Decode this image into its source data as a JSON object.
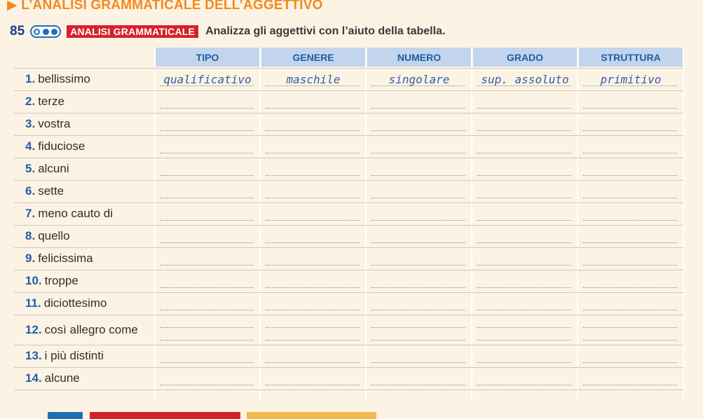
{
  "section_title": "▶ L’ANALISI GRAMMATICALE DELL’AGGETTIVO",
  "exercise": {
    "number": "85",
    "tag": "ANALISI GRAMMATICALE",
    "instruction": "Analizza gli aggettivi con l’aiuto della tabella."
  },
  "columns": [
    "TIPO",
    "GENERE",
    "NUMERO",
    "GRADO",
    "STRUTTURA"
  ],
  "example_answers": [
    "qualificativo",
    "maschile",
    "singolare",
    "sup. assoluto",
    "primitivo"
  ],
  "rows": [
    {
      "n": "1.",
      "word": "bellissimo"
    },
    {
      "n": "2.",
      "word": "terze"
    },
    {
      "n": "3.",
      "word": "vostra"
    },
    {
      "n": "4.",
      "word": "fiduciose"
    },
    {
      "n": "5.",
      "word": "alcuni"
    },
    {
      "n": "6.",
      "word": "sette"
    },
    {
      "n": "7.",
      "word": "meno cauto di"
    },
    {
      "n": "8.",
      "word": "quello"
    },
    {
      "n": "9.",
      "word": "felicissima"
    },
    {
      "n": "10.",
      "word": "troppe"
    },
    {
      "n": "11.",
      "word": "diciottesimo"
    },
    {
      "n": "12.",
      "word": "così allegro come"
    },
    {
      "n": "13.",
      "word": "i più distinti"
    },
    {
      "n": "14.",
      "word": "alcune"
    }
  ],
  "colors": {
    "page_bg": "#fdf3e4",
    "section_title": "#f18a1c",
    "header_bg": "#c2d5ec",
    "header_text": "#1e5ea7",
    "tag_bg": "#d7212a",
    "handwriting": "#2e5fa8"
  }
}
